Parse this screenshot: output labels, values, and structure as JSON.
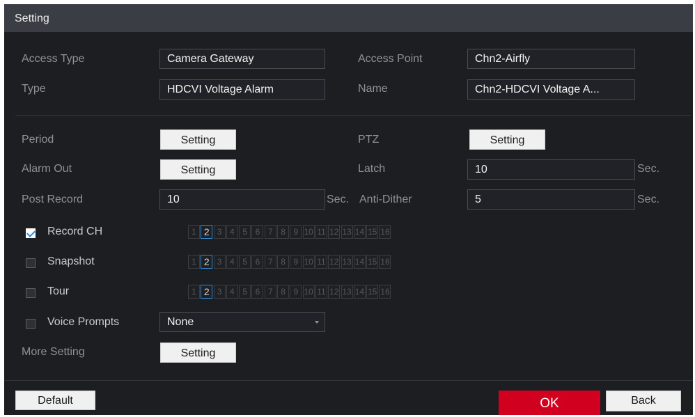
{
  "title": "Setting",
  "access_type": {
    "label": "Access Type",
    "value": "Camera Gateway"
  },
  "access_point": {
    "label": "Access Point",
    "value": "Chn2-Airfly"
  },
  "type": {
    "label": "Type",
    "value": "HDCVI Voltage Alarm"
  },
  "name": {
    "label": "Name",
    "value": "Chn2-HDCVI Voltage A..."
  },
  "period": {
    "label": "Period",
    "button": "Setting"
  },
  "ptz": {
    "label": "PTZ",
    "button": "Setting"
  },
  "alarm_out": {
    "label": "Alarm Out",
    "button": "Setting"
  },
  "latch": {
    "label": "Latch",
    "value": "10",
    "unit": "Sec."
  },
  "post_record": {
    "label": "Post Record",
    "value": "10",
    "unit": "Sec."
  },
  "anti_dither": {
    "label": "Anti-Dither",
    "value": "5",
    "unit": "Sec."
  },
  "record_ch": {
    "label": "Record CH",
    "checked": true
  },
  "snapshot": {
    "label": "Snapshot",
    "checked": false
  },
  "tour": {
    "label": "Tour",
    "checked": false
  },
  "voice_prompts": {
    "label": "Voice Prompts",
    "checked": false,
    "value": "None"
  },
  "channels": [
    "1",
    "2",
    "3",
    "4",
    "5",
    "6",
    "7",
    "8",
    "9",
    "10",
    "11",
    "12",
    "13",
    "14",
    "15",
    "16"
  ],
  "selected_channel": "2",
  "more_setting": {
    "label": "More Setting",
    "button": "Setting"
  },
  "footer": {
    "default": "Default",
    "ok": "OK",
    "back": "Back"
  },
  "colors": {
    "background": "#1d1e22",
    "titlebar": "#3b3d44",
    "ok": "#d2001e",
    "accent": "#2f8ad8"
  }
}
